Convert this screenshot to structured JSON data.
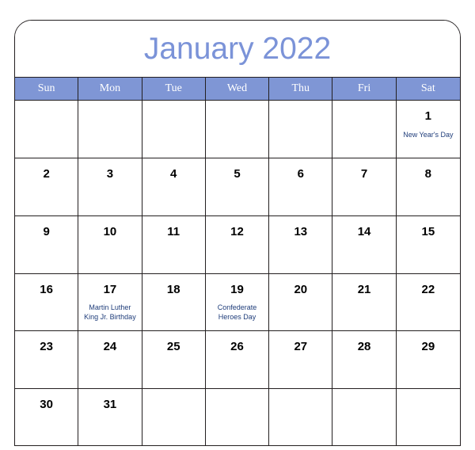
{
  "calendar": {
    "title": "January 2022",
    "title_color": "#7b93d8",
    "header_band_color": "#7f96d5",
    "event_text_color": "#1f3d7a",
    "grid_line_color": "#231f20",
    "weekdays": [
      {
        "label": "Sun"
      },
      {
        "label": "Mon"
      },
      {
        "label": "Tue"
      },
      {
        "label": "Wed"
      },
      {
        "label": "Thu"
      },
      {
        "label": "Fri"
      },
      {
        "label": "Sat"
      }
    ],
    "weeks": [
      [
        {
          "day": "",
          "event": ""
        },
        {
          "day": "",
          "event": ""
        },
        {
          "day": "",
          "event": ""
        },
        {
          "day": "",
          "event": ""
        },
        {
          "day": "",
          "event": ""
        },
        {
          "day": "",
          "event": ""
        },
        {
          "day": "1",
          "event": "New Year's Day"
        }
      ],
      [
        {
          "day": "2",
          "event": ""
        },
        {
          "day": "3",
          "event": ""
        },
        {
          "day": "4",
          "event": ""
        },
        {
          "day": "5",
          "event": ""
        },
        {
          "day": "6",
          "event": ""
        },
        {
          "day": "7",
          "event": ""
        },
        {
          "day": "8",
          "event": ""
        }
      ],
      [
        {
          "day": "9",
          "event": ""
        },
        {
          "day": "10",
          "event": ""
        },
        {
          "day": "11",
          "event": ""
        },
        {
          "day": "12",
          "event": ""
        },
        {
          "day": "13",
          "event": ""
        },
        {
          "day": "14",
          "event": ""
        },
        {
          "day": "15",
          "event": ""
        }
      ],
      [
        {
          "day": "16",
          "event": ""
        },
        {
          "day": "17",
          "event": "Martin Luther\nKing Jr. Birthday"
        },
        {
          "day": "18",
          "event": ""
        },
        {
          "day": "19",
          "event": "Confederate\nHeroes Day"
        },
        {
          "day": "20",
          "event": ""
        },
        {
          "day": "21",
          "event": ""
        },
        {
          "day": "22",
          "event": ""
        }
      ],
      [
        {
          "day": "23",
          "event": ""
        },
        {
          "day": "24",
          "event": ""
        },
        {
          "day": "25",
          "event": ""
        },
        {
          "day": "26",
          "event": ""
        },
        {
          "day": "27",
          "event": ""
        },
        {
          "day": "28",
          "event": ""
        },
        {
          "day": "29",
          "event": ""
        }
      ],
      [
        {
          "day": "30",
          "event": ""
        },
        {
          "day": "31",
          "event": ""
        },
        {
          "day": "",
          "event": ""
        },
        {
          "day": "",
          "event": ""
        },
        {
          "day": "",
          "event": ""
        },
        {
          "day": "",
          "event": ""
        },
        {
          "day": "",
          "event": ""
        }
      ]
    ]
  }
}
